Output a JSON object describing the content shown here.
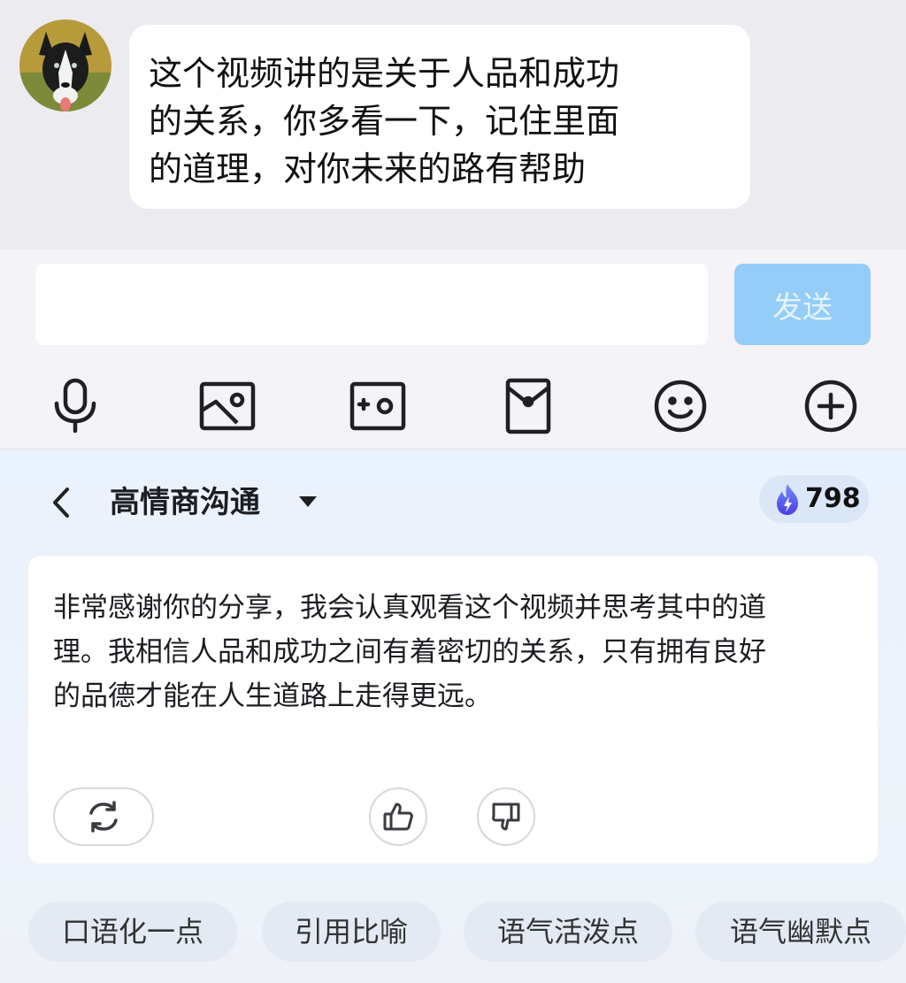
{
  "chat": {
    "message_lines": [
      "这个视频讲的是关于人品和成功",
      "的关系，你多看一下，记住里面",
      "的道理，对你未来的路有帮助"
    ],
    "avatar_icon": "dog-avatar"
  },
  "composer": {
    "input_value": "",
    "send_label": "发送",
    "toolbar_icons": [
      "microphone-icon",
      "image-icon",
      "camera-icon",
      "red-envelope-icon",
      "emoji-icon",
      "plus-icon"
    ]
  },
  "assistant": {
    "title": "高情商沟通",
    "points": "798",
    "reply_lines": [
      "非常感谢你的分享，我会认真观看这个视频并思考其中的道",
      "理。我相信人品和成功之间有着密切的关系，只有拥有良好",
      "的品德才能在人生道路上走得更远。"
    ],
    "chips": [
      "口语化一点",
      "引用比喻",
      "语气活泼点",
      "语气幽默点"
    ]
  },
  "colors": {
    "send_button": "#93cdf8",
    "panel_bg": "#eaf2fd",
    "icon_stroke": "#1f1f24"
  }
}
